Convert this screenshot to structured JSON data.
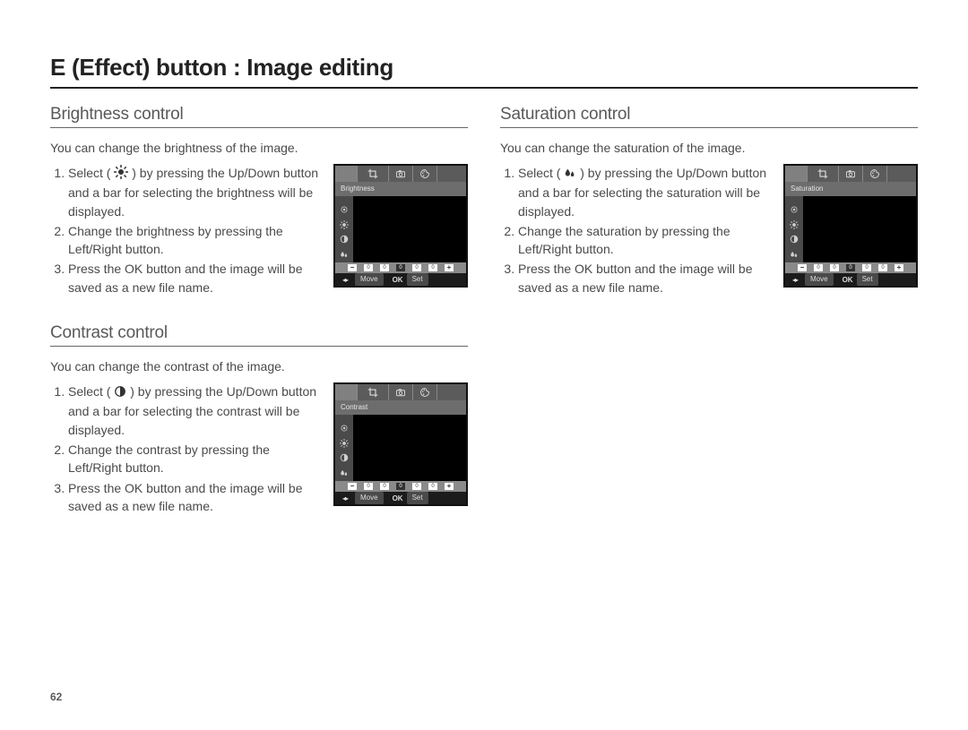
{
  "page_title": "E (Effect) button : Image editing",
  "page_number": "62",
  "cam_common": {
    "top_first": "",
    "move": "Move",
    "ok": "OK",
    "set": "Set",
    "slider_minus": "−",
    "slider_plus": "+",
    "slider_ticks": [
      "0",
      "0",
      "0",
      "0",
      "0"
    ]
  },
  "sections": {
    "brightness": {
      "title": "Brightness control",
      "intro": "You can change the brightness of the image.",
      "cam_label": "Brightness",
      "icon": "sun",
      "step1_a": "Select (",
      "step1_b": ") by pressing the Up/Down button and a bar for selecting the brightness will be displayed.",
      "step2": "Change the brightness by pressing the Left/Right button.",
      "step3": "Press the OK button and the image will be saved as a new file name."
    },
    "contrast": {
      "title": "Contrast control",
      "intro": "You can change the contrast of the image.",
      "cam_label": "Contrast",
      "icon": "contrast",
      "step1_a": "Select (",
      "step1_b": ") by pressing the Up/Down button and a bar for selecting the contrast will be displayed.",
      "step2": "Change the contrast by pressing the Left/Right button.",
      "step3": "Press the OK button and the image will be saved as a new file name."
    },
    "saturation": {
      "title": "Saturation control",
      "intro": "You can change the saturation of the image.",
      "cam_label": "Saturation",
      "icon": "drops",
      "step1_a": "Select (",
      "step1_b": ") by pressing the Up/Down button and a bar for selecting the saturation will be displayed.",
      "step2": "Change the saturation by pressing the Left/Right button.",
      "step3": "Press the OK button and the image will be saved as a new file name."
    }
  }
}
